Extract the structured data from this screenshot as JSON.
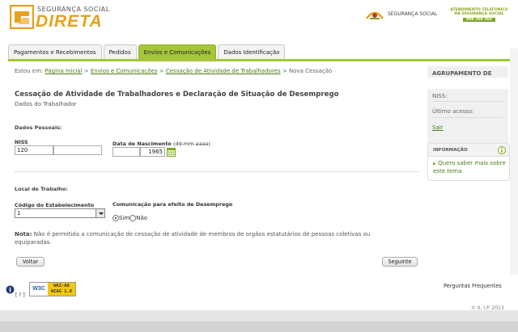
{
  "header": {
    "logo_line1": "SEGURANÇA SOCIAL",
    "logo_line2": "DIRETA",
    "brand": "SEGURANÇA SOCIAL",
    "support_line1": "ATENDIMENTO TELEFÓNICO",
    "support_line2": "DA SEGURANÇA SOCIAL",
    "support_number": "808 266 266"
  },
  "tabs": [
    {
      "label": "Pagamentos e Recebimentos",
      "active": false
    },
    {
      "label": "Pedidos",
      "active": false
    },
    {
      "label": "Envios e Comunicações",
      "active": true
    },
    {
      "label": "Dados Identificação",
      "active": false
    }
  ],
  "breadcrumb": {
    "prefix": "Estou em:",
    "items": [
      "Página Inicial",
      "Envios e Comunicações",
      "Cessação de Atividade de Trabalhadores"
    ],
    "current": "Nova Cessação",
    "separator": ">"
  },
  "page": {
    "title": "Cessação de Atividade de Trabalhadores e Declaração de Situação de Desemprego",
    "subtitle": "Dados do Trabalhador"
  },
  "personal": {
    "section": "Dados Pessoais:",
    "niss_label": "NISS",
    "niss_value": "120",
    "dob_label": "Data de Nascimento",
    "dob_hint": "(dd-mm-aaaa)",
    "dob_year": "1965"
  },
  "workplace": {
    "section": "Local de Trabalho:",
    "establishment_label": "Código do Estabelecimento",
    "establishment_value": "1",
    "unemployment_label": "Comunicação para efeito de Desemprego",
    "option_yes": "Sim",
    "option_no": "Não",
    "selected": "Sim"
  },
  "note": {
    "label": "Nota:",
    "text": "Não é permitida a comunicação de cessação de atividade de membros de orgãos estatutários de pessoas coletivas ou equiparadas."
  },
  "buttons": {
    "back": "Voltar",
    "next": "Seguinte"
  },
  "sidebar": {
    "group_title": "AGRUPAMENTO DE",
    "niss_label": "NISS:",
    "last_access_label": "Último acesso:",
    "logout": "Sair",
    "info_title": "INFORMAÇÃO",
    "info_link": "Quero saber mais sobre este tema"
  },
  "footer": {
    "help_label": "[ ? ]",
    "w3c": "W3C",
    "wai_line1": "WAI-AA",
    "wai_line2": "WCAG 1.0",
    "faq": "Perguntas Frequentes",
    "copyright": "© II, I.P. 2013"
  },
  "colors": {
    "accent_green": "#a5c53a",
    "link_green": "#4a7a16",
    "logo_orange": "#e6a21e"
  }
}
